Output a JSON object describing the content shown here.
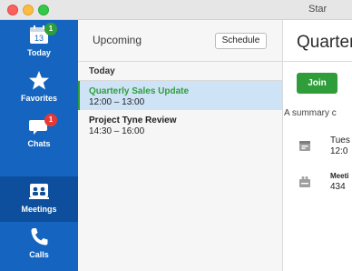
{
  "window": {
    "title": "Star"
  },
  "sidebar": {
    "items": [
      {
        "label": "Today",
        "icon": "calendar-icon",
        "date": "13",
        "badge": "1",
        "badge_color": "#2e9e3a"
      },
      {
        "label": "Favorites",
        "icon": "star-icon"
      },
      {
        "label": "Chats",
        "icon": "chat-icon",
        "badge": "1",
        "badge_color": "#e53935"
      },
      {
        "label": "Meetings",
        "icon": "meetings-icon",
        "active": true
      },
      {
        "label": "Calls",
        "icon": "phone-icon"
      }
    ]
  },
  "list": {
    "title": "Upcoming",
    "schedule_label": "Schedule",
    "section": "Today",
    "items": [
      {
        "title": "Quarterly Sales Update",
        "time": "12:00 – 13:00",
        "selected": true
      },
      {
        "title": "Project Tyne Review",
        "time": "14:30 – 16:00"
      }
    ]
  },
  "detail": {
    "title": "Quarterly",
    "join_label": "Join",
    "summary": "A summary c",
    "date_line1": "Tues",
    "date_line2": "12:0",
    "meeting_label": "Meeti",
    "meeting_value": "434"
  },
  "colors": {
    "sidebar": "#1565c0",
    "sidebar_active": "#0d4f9c",
    "accent_green": "#2e9e3a",
    "selection": "#cfe3f7"
  }
}
